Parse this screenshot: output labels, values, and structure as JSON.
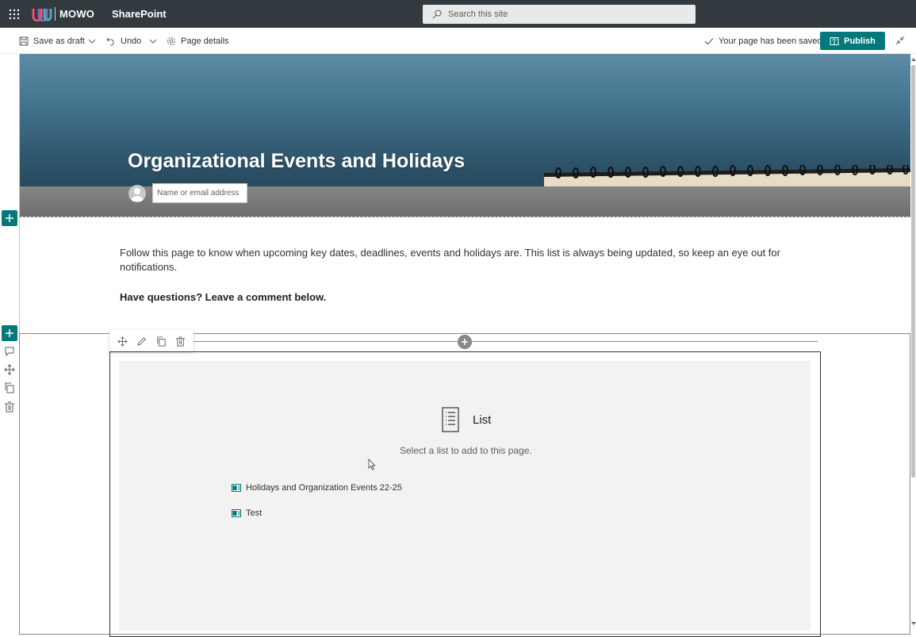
{
  "suite": {
    "org_name": "MOWO",
    "app_name": "SharePoint",
    "search_placeholder": "Search this site"
  },
  "toolbar": {
    "save_draft": "Save as draft",
    "undo": "Undo",
    "page_details": "Page details",
    "saved_status": "Your page has been saved",
    "publish": "Publish"
  },
  "hero": {
    "title": "Organizational Events and Holidays",
    "author_placeholder": "Name or email address"
  },
  "content": {
    "intro": "Follow this page to know when upcoming key dates, deadlines, events and holidays are.  This list is always being updated, so keep an eye out for notifications.",
    "question": "Have questions?  Leave a comment below."
  },
  "webpart": {
    "title": "List",
    "subtitle": "Select a list to add to this page.",
    "lists": [
      "Holidays and Organization Events 22-25",
      "Test"
    ]
  },
  "colors": {
    "suite_bar": "#333a3f",
    "accent": "#03787c"
  }
}
